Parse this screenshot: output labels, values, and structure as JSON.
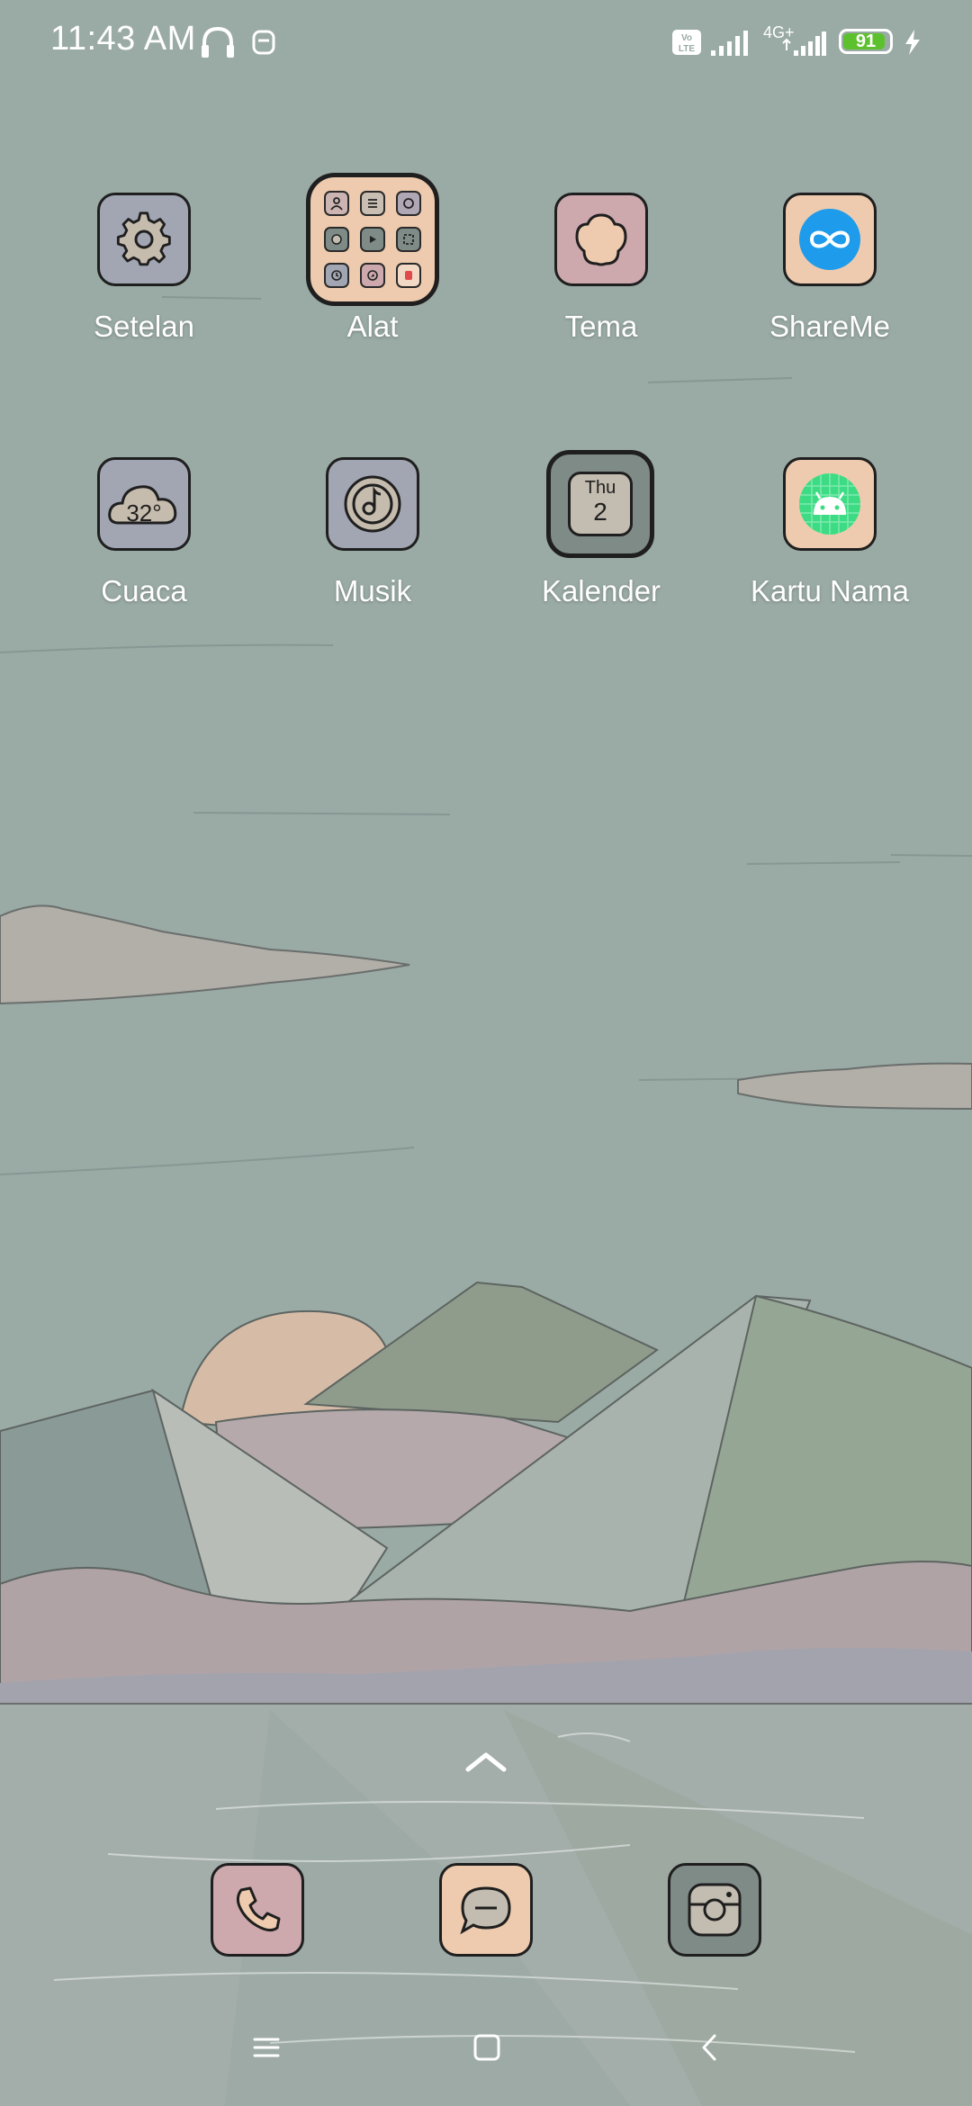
{
  "status_bar": {
    "time": "11:43 AM",
    "network_type": "4G+",
    "battery_level": "91",
    "battery_fraction": 0.91,
    "icons": [
      "headphones-icon",
      "face-unlock-icon",
      "volte-icon",
      "signal-icon",
      "signal-icon",
      "battery-icon",
      "charging-icon"
    ]
  },
  "apps": [
    {
      "label": "Setelan",
      "icon": "gear-icon"
    },
    {
      "label": "Alat",
      "icon": "folder-icon"
    },
    {
      "label": "Tema",
      "icon": "flower-icon"
    },
    {
      "label": "ShareMe",
      "icon": "infinity-icon"
    },
    {
      "label": "Cuaca",
      "icon": "cloud-icon",
      "temperature": "32°"
    },
    {
      "label": "Musik",
      "icon": "music-disc-icon"
    },
    {
      "label": "Kalender",
      "icon": "calendar-icon",
      "day_of_week": "Thu",
      "day": "2"
    },
    {
      "label": "Kartu Nama",
      "icon": "android-icon"
    }
  ],
  "dock": [
    {
      "icon": "phone-icon"
    },
    {
      "icon": "message-icon"
    },
    {
      "icon": "camera-icon"
    }
  ],
  "nav_bar": {
    "icons": [
      "menu-icon",
      "home-icon",
      "back-icon"
    ]
  },
  "colors": {
    "sky": "#9aaaa5",
    "tile_slate": "#a2a6b3",
    "tile_peach": "#eecbae",
    "tile_pink": "#cda9ae",
    "tile_teal": "#7f8b87",
    "shareme_blue": "#1e9bea",
    "android_green": "#3ddc84"
  }
}
